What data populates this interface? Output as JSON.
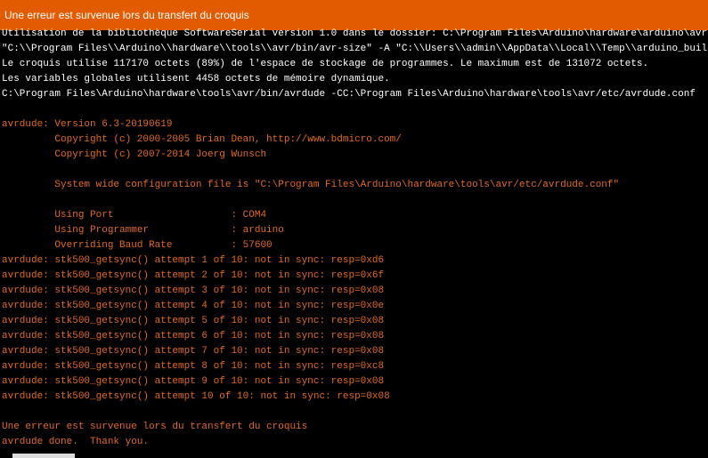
{
  "status": {
    "message": "Une erreur est survenue lors du transfert du croquis"
  },
  "console": {
    "lines": [
      {
        "text": "Utilisation de la bibliothèque SoftwareSerial version 1.0 dans le dossier: C:\\Program Files\\Arduino\\hardware\\arduino\\avr\\libraries\\SoftwareSerial",
        "color": "white"
      },
      {
        "text": "\"C:\\\\Program Files\\\\Arduino\\\\hardware\\\\tools\\\\avr/bin/avr-size\" -A \"C:\\\\Users\\\\admin\\\\AppData\\\\Local\\\\Temp\\\\arduino_build",
        "color": "white"
      },
      {
        "text": "Le croquis utilise 117170 octets (89%) de l'espace de stockage de programmes. Le maximum est de 131072 octets.",
        "color": "white"
      },
      {
        "text": "Les variables globales utilisent 4458 octets de mémoire dynamique.",
        "color": "white"
      },
      {
        "text": "C:\\Program Files\\Arduino\\hardware\\tools\\avr/bin/avrdude -CC:\\Program Files\\Arduino\\hardware\\tools\\avr/etc/avrdude.conf",
        "color": "white"
      },
      {
        "text": "",
        "color": "white"
      },
      {
        "text": "avrdude: Version 6.3-20190619",
        "color": "orange"
      },
      {
        "text": "         Copyright (c) 2000-2005 Brian Dean, http://www.bdmicro.com/",
        "color": "orange"
      },
      {
        "text": "         Copyright (c) 2007-2014 Joerg Wunsch",
        "color": "orange"
      },
      {
        "text": "",
        "color": "orange"
      },
      {
        "text": "         System wide configuration file is \"C:\\Program Files\\Arduino\\hardware\\tools\\avr/etc/avrdude.conf\"",
        "color": "orange"
      },
      {
        "text": "",
        "color": "orange"
      },
      {
        "text": "         Using Port                    : COM4",
        "color": "orange"
      },
      {
        "text": "         Using Programmer              : arduino",
        "color": "orange"
      },
      {
        "text": "         Overriding Baud Rate          : 57600",
        "color": "orange"
      },
      {
        "text": "avrdude: stk500_getsync() attempt 1 of 10: not in sync: resp=0xd6",
        "color": "orange"
      },
      {
        "text": "avrdude: stk500_getsync() attempt 2 of 10: not in sync: resp=0x6f",
        "color": "orange"
      },
      {
        "text": "avrdude: stk500_getsync() attempt 3 of 10: not in sync: resp=0x08",
        "color": "orange"
      },
      {
        "text": "avrdude: stk500_getsync() attempt 4 of 10: not in sync: resp=0x0e",
        "color": "orange"
      },
      {
        "text": "avrdude: stk500_getsync() attempt 5 of 10: not in sync: resp=0x08",
        "color": "orange"
      },
      {
        "text": "avrdude: stk500_getsync() attempt 6 of 10: not in sync: resp=0x08",
        "color": "orange"
      },
      {
        "text": "avrdude: stk500_getsync() attempt 7 of 10: not in sync: resp=0x08",
        "color": "orange"
      },
      {
        "text": "avrdude: stk500_getsync() attempt 8 of 10: not in sync: resp=0xc8",
        "color": "orange"
      },
      {
        "text": "avrdude: stk500_getsync() attempt 9 of 10: not in sync: resp=0x08",
        "color": "orange"
      },
      {
        "text": "avrdude: stk500_getsync() attempt 10 of 10: not in sync: resp=0x08",
        "color": "orange"
      },
      {
        "text": "",
        "color": "orange"
      },
      {
        "text": "Une erreur est survenue lors du transfert du croquis",
        "color": "orange"
      },
      {
        "text": "avrdude done.  Thank you.",
        "color": "orange"
      }
    ]
  },
  "colors": {
    "status_bg": "#e35b00",
    "console_bg": "#000000",
    "text_white": "#ffffff",
    "text_orange": "#e06a1e"
  }
}
